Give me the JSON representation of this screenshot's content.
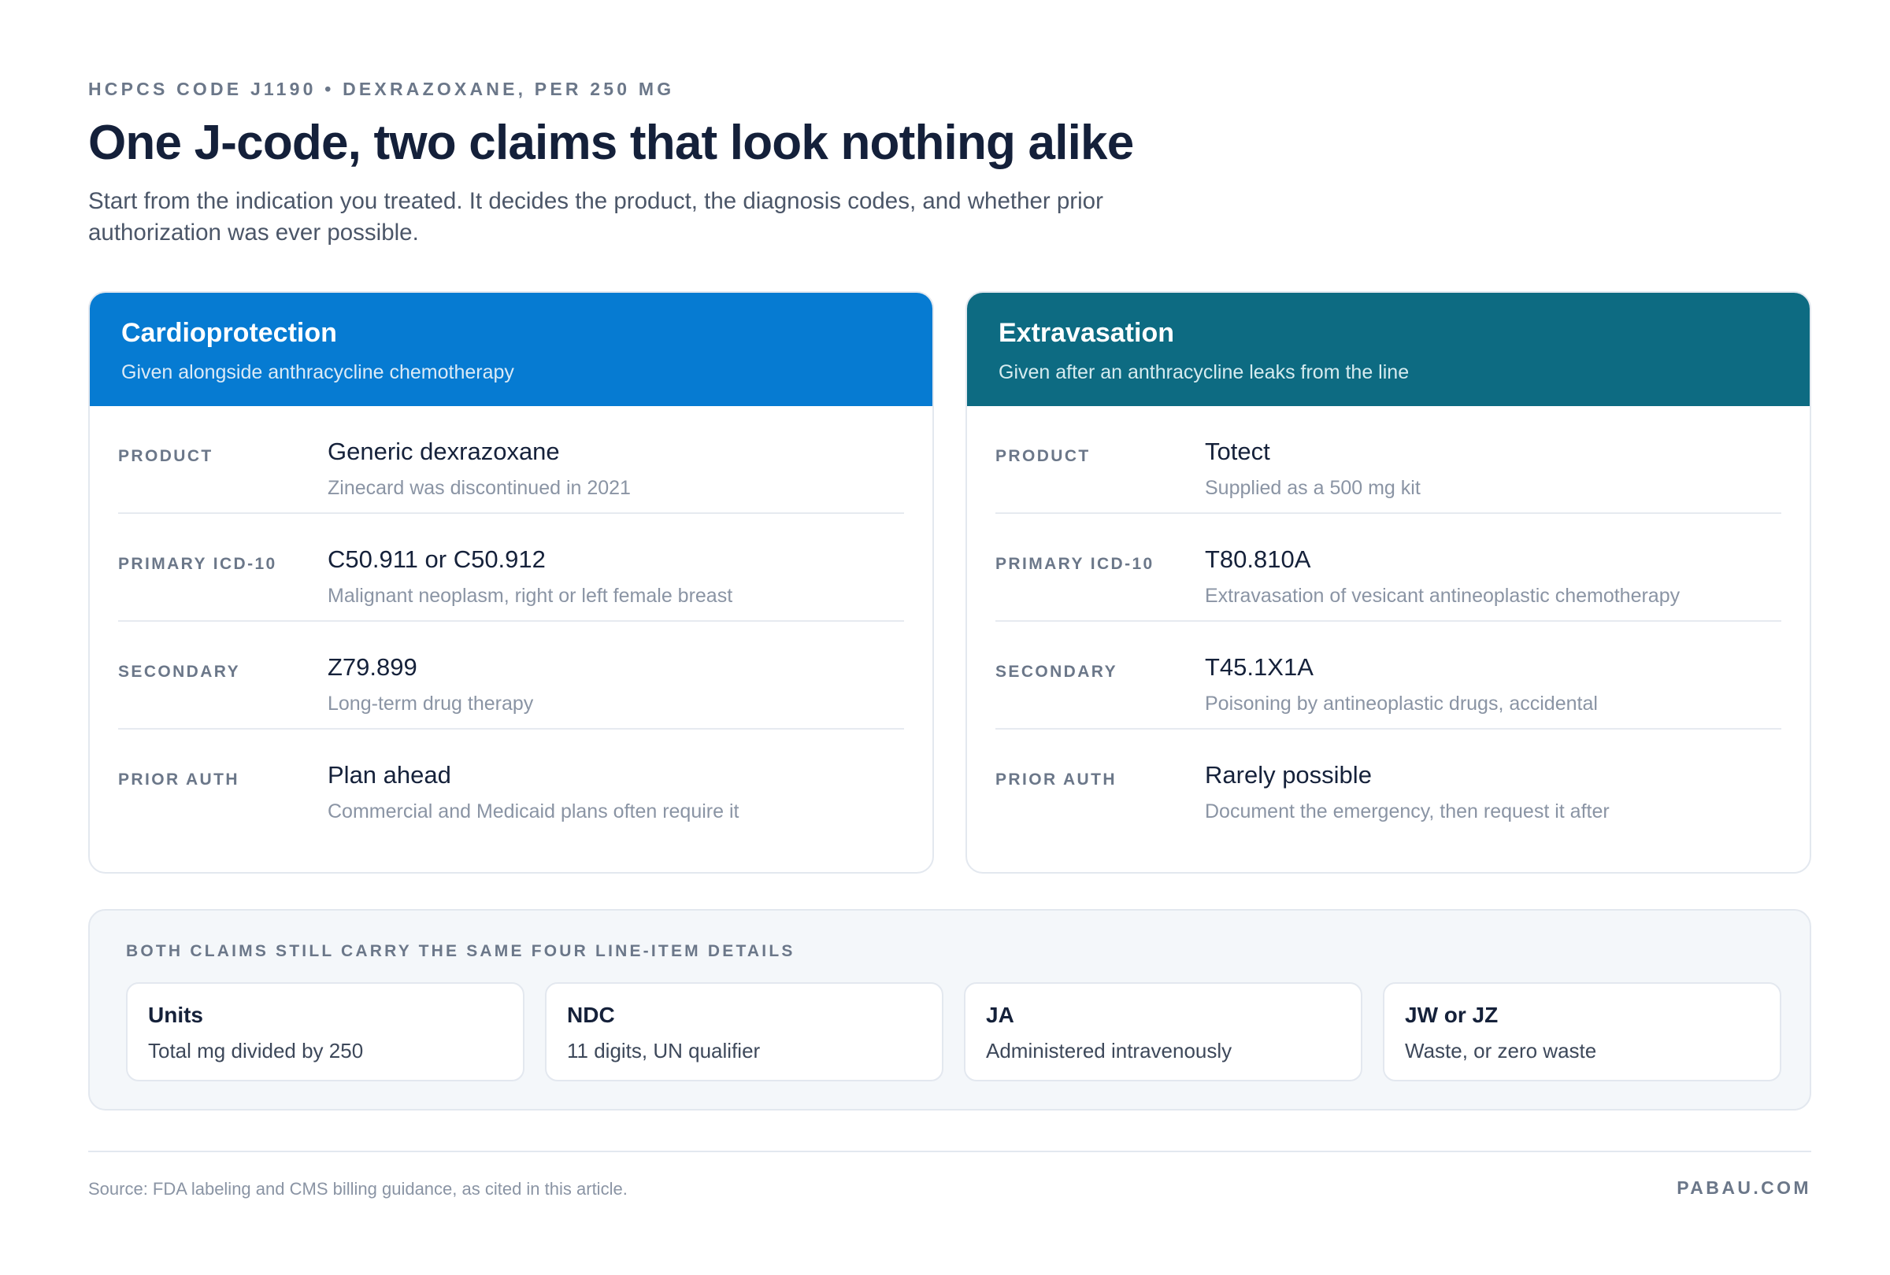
{
  "header": {
    "eyebrow": "HCPCS CODE J1190 • DEXRAZOXANE, PER 250 MG",
    "title": "One J-code, two claims that look nothing alike",
    "subtitle": "Start from the indication you treated. It decides the product, the diagnosis codes, and whether prior authorization was ever possible."
  },
  "cards": [
    {
      "title": "Cardioprotection",
      "subtitle": "Given alongside anthracycline chemotherapy",
      "color": "#067bd2",
      "rows": [
        {
          "label": "PRODUCT",
          "main": "Generic dexrazoxane",
          "note": "Zinecard was discontinued in 2021"
        },
        {
          "label": "PRIMARY ICD-10",
          "main": "C50.911 or C50.912",
          "note": "Malignant neoplasm, right or left female breast"
        },
        {
          "label": "SECONDARY",
          "main": "Z79.899",
          "note": "Long-term drug therapy"
        },
        {
          "label": "PRIOR AUTH",
          "main": "Plan ahead",
          "note": "Commercial and Medicaid plans often require it"
        }
      ]
    },
    {
      "title": "Extravasation",
      "subtitle": "Given after an anthracycline leaks from the line",
      "color": "#0d6b82",
      "rows": [
        {
          "label": "PRODUCT",
          "main": "Totect",
          "note": "Supplied as a 500 mg kit"
        },
        {
          "label": "PRIMARY ICD-10",
          "main": "T80.810A",
          "note": "Extravasation of vesicant antineoplastic chemotherapy"
        },
        {
          "label": "SECONDARY",
          "main": "T45.1X1A",
          "note": "Poisoning by antineoplastic drugs, accidental"
        },
        {
          "label": "PRIOR AUTH",
          "main": "Rarely possible",
          "note": "Document the emergency, then request it after"
        }
      ]
    }
  ],
  "line_items": {
    "label": "BOTH CLAIMS STILL CARRY THE SAME FOUR LINE-ITEM DETAILS",
    "items": [
      {
        "title": "Units",
        "sub": "Total mg divided by 250"
      },
      {
        "title": "NDC",
        "sub": "11 digits, UN qualifier"
      },
      {
        "title": "JA",
        "sub": "Administered intravenously"
      },
      {
        "title": "JW or JZ",
        "sub": "Waste, or zero waste"
      }
    ]
  },
  "footer": {
    "source": "Source: FDA labeling and CMS billing guidance, as cited in this article.",
    "brand": "PABAU.COM"
  }
}
